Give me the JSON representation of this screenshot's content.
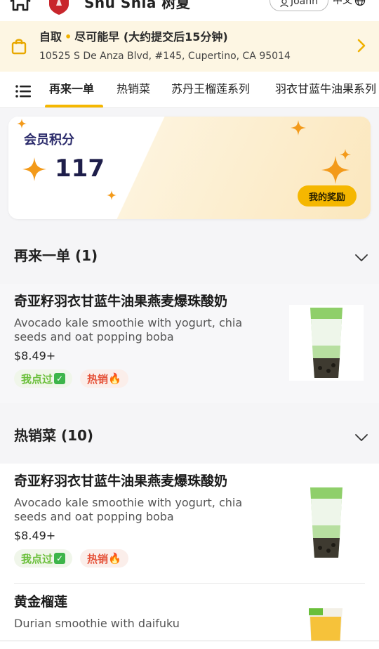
{
  "header": {
    "brand": "Shu Shia 树夏",
    "user": "Joann",
    "language": "中文"
  },
  "pickup": {
    "mode": "自取",
    "timing": "尽可能早 (大约提交后15分钟)",
    "address": "10525 S De Anza Blvd, #145, Cupertino, CA 95014"
  },
  "tabs": [
    {
      "label": "再来一单"
    },
    {
      "label": "热销菜"
    },
    {
      "label": "苏丹王榴莲系列"
    },
    {
      "label": "羽衣甘蓝牛油果系列"
    }
  ],
  "points": {
    "label": "会员积分",
    "value": "117",
    "rewards_button": "我的奖励"
  },
  "sections": [
    {
      "title": "再来一单 (1)"
    },
    {
      "title": "热销菜 (10)"
    }
  ],
  "items": [
    {
      "name": "奇亚籽羽衣甘蓝牛油果燕麦爆珠酸奶",
      "description": "Avocado kale smoothie with yogurt, chia seeds and oat popping boba",
      "price": "$8.49+",
      "tag_ordered": "我点过",
      "tag_hot": "热销"
    },
    {
      "name": "奇亚籽羽衣甘蓝牛油果燕麦爆珠酸奶",
      "description": "Avocado kale smoothie with yogurt, chia seeds and oat popping boba",
      "price": "$8.49+",
      "tag_ordered": "我点过",
      "tag_hot": "热销"
    },
    {
      "name": "黄金榴莲",
      "description": "Durian smoothie with daifuku"
    }
  ],
  "colors": {
    "accent": "#f5b700",
    "banner_bg": "#fdf6e3",
    "ordered_green": "#6abf3a",
    "hot_red": "#e5533a"
  },
  "icons": {
    "home": "home-icon",
    "bag": "shopping-bag-icon",
    "menu": "menu-icon",
    "star": "sparkle-star-icon",
    "chevron": "chevron-down-icon",
    "globe": "globe-icon"
  }
}
